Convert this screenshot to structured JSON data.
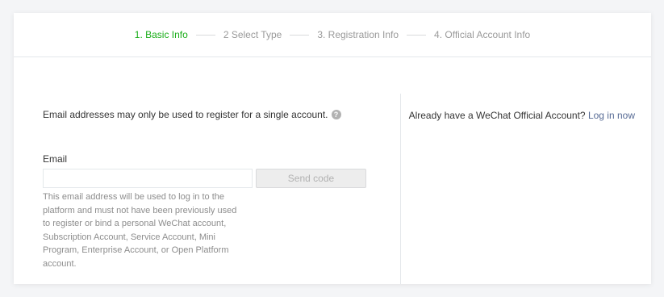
{
  "steps": [
    {
      "label": "1. Basic Info",
      "active": true
    },
    {
      "label": "2 Select Type",
      "active": false
    },
    {
      "label": "3. Registration Info",
      "active": false
    },
    {
      "label": "4. Official Account Info",
      "active": false
    }
  ],
  "form": {
    "notice": "Email addresses may only be used to register for a single account.",
    "help_icon_glyph": "?",
    "email_label": "Email",
    "email_value": "",
    "email_placeholder": "",
    "send_code_label": "Send code",
    "email_tip": "This email address will be used to log in to the platform and must not have been previously used to register or bind a personal WeChat account, Subscription Account, Service Account, Mini Program, Enterprise Account, or Open Platform account."
  },
  "sidebar": {
    "prompt": "Already have a WeChat Official Account?",
    "login_link": "Log in now"
  },
  "colors": {
    "active_step": "#1aad19",
    "inactive_step": "#9a9a9a",
    "link": "#576b95",
    "disabled_button_bg": "#ededed"
  },
  "icons": {
    "help": "question-circle-icon"
  }
}
